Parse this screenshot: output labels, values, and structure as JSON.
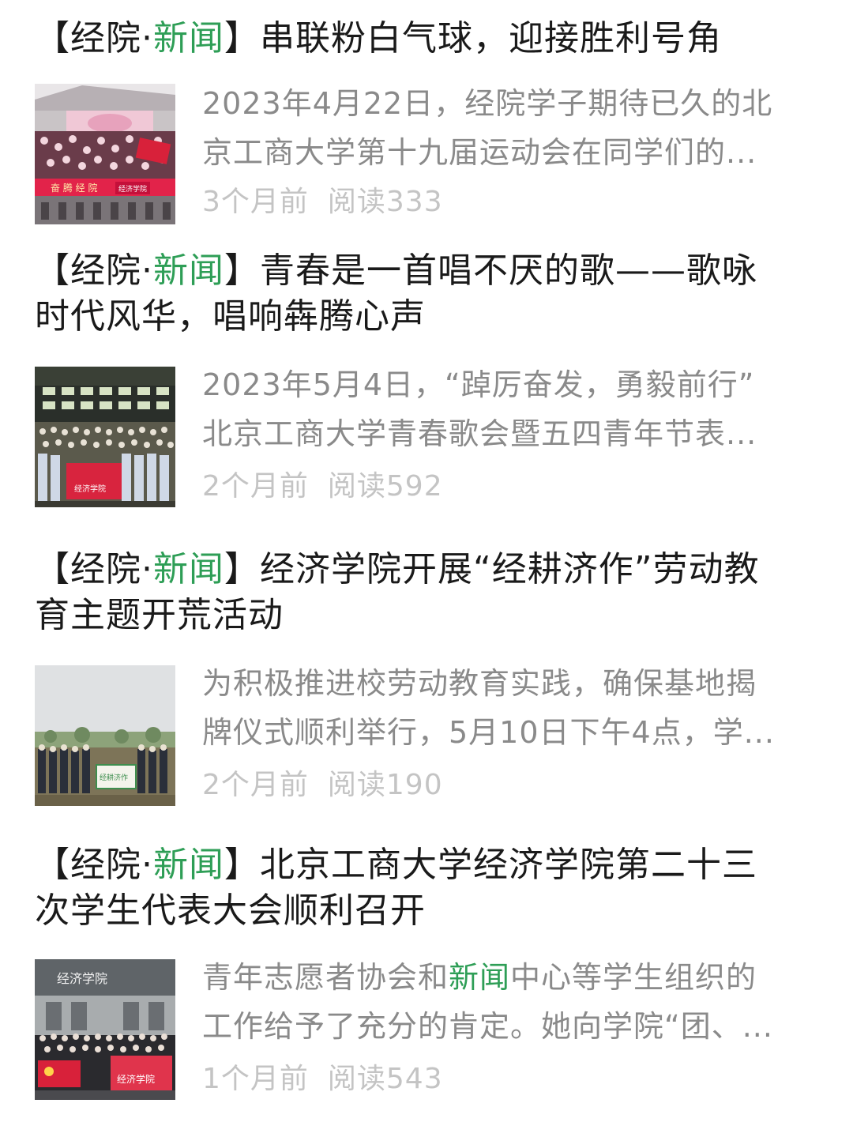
{
  "colors": {
    "title": "#1a1a1a",
    "accent_green": "#2e9e56",
    "summary": "#8a8a8a",
    "meta": "#c4c4c4",
    "background": "#ffffff"
  },
  "articles": [
    {
      "title_prefix": "【经院·",
      "title_highlight": "新闻",
      "title_rest_line1": "】串联粉白气球，迎接胜利号角",
      "title_line2": "",
      "summary_line1": "2023年4月22日，经院学子期待已久的北",
      "summary_line2_pre": "京工商大学第十九届运动会在同学们的...",
      "summary_line2_hl": "",
      "summary_line2_post": "",
      "time": "3个月前",
      "reads": "阅读333",
      "thumb": "sports-meet-photo",
      "thumb_banner": "经济学院"
    },
    {
      "title_prefix": "【经院·",
      "title_highlight": "新闻",
      "title_rest_line1": "】青春是一首唱不厌的歌——歌咏",
      "title_line2": "时代风华，唱响犇腾心声",
      "summary_line1": "2023年5月4日，“踔厉奋发，勇毅前行”",
      "summary_line2_pre": "北京工商大学青春歌会暨五四青年节表...",
      "summary_line2_hl": "",
      "summary_line2_post": "",
      "time": "2个月前",
      "reads": "阅读592",
      "thumb": "choir-group-photo",
      "thumb_banner": "经济学院"
    },
    {
      "title_prefix": "【经院·",
      "title_highlight": "新闻",
      "title_rest_line1": "】经济学院开展“经耕济作”劳动教",
      "title_line2": "育主题开荒活动",
      "summary_line1": "为积极推进校劳动教育实践，确保基地揭",
      "summary_line2_pre": "牌仪式顺利举行，5月10日下午4点，学...",
      "summary_line2_hl": "",
      "summary_line2_post": "",
      "time": "2个月前",
      "reads": "阅读190",
      "thumb": "field-group-photo",
      "thumb_banner": "经耕济作"
    },
    {
      "title_prefix": "【经院·",
      "title_highlight": "新闻",
      "title_rest_line1": "】北京工商大学经济学院第二十三",
      "title_line2": "次学生代表大会顺利召开",
      "summary_line1_pre": "青年志愿者协会和",
      "summary_line1_hl": "新闻",
      "summary_line1_post": "中心等学生组织的",
      "summary_line2_pre": "工作给予了充分的肯定。她向学院“团、...",
      "time": "1个月前",
      "reads": "阅读543",
      "thumb": "building-group-photo",
      "thumb_sign": "经济学院",
      "thumb_banner": "经济学院"
    }
  ]
}
